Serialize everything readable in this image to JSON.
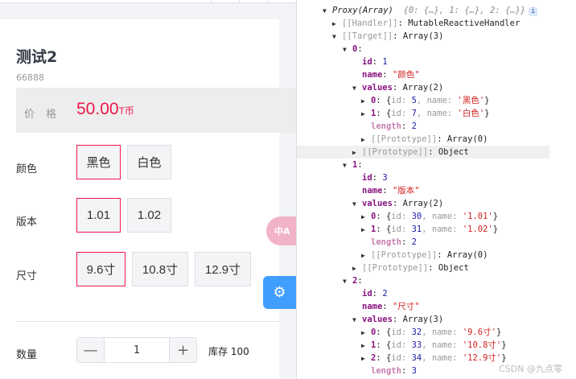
{
  "product": {
    "title": "测试2",
    "code": "66888",
    "price_label": "价格",
    "price": "50.00",
    "currency": "T币",
    "specs": [
      {
        "label": "颜色",
        "options": [
          {
            "name": "黑色",
            "selected": true
          },
          {
            "name": "白色",
            "selected": false
          }
        ]
      },
      {
        "label": "版本",
        "options": [
          {
            "name": "1.01",
            "selected": true
          },
          {
            "name": "1.02",
            "selected": false
          }
        ]
      },
      {
        "label": "尺寸",
        "options": [
          {
            "name": "9.6寸",
            "selected": true
          },
          {
            "name": "10.8寸",
            "selected": false
          },
          {
            "name": "12.9寸",
            "selected": false
          }
        ]
      }
    ],
    "quantity_label": "数量",
    "quantity": "1",
    "minus": "—",
    "plus": "+",
    "stock": "库存 100"
  },
  "floating": {
    "translate_icon": "中A",
    "settings_icon": "⚙"
  },
  "accent": "#f0164a",
  "devtools": {
    "lines": [
      {
        "d": 0,
        "a": "down",
        "parts": [
          {
            "t": "Proxy(Array)  ",
            "c": "i"
          },
          {
            "t": "{0: {…}, 1: {…}, 2: {…}}",
            "c": "ig"
          }
        ],
        "info": "i"
      },
      {
        "d": 1,
        "a": "right",
        "parts": [
          {
            "t": "[[Handler]]",
            "c": "g"
          },
          {
            "t": ": MutableReactiveHandler",
            "c": "p"
          }
        ]
      },
      {
        "d": 1,
        "a": "down",
        "parts": [
          {
            "t": "[[Target]]",
            "c": "g"
          },
          {
            "t": ": Array(3)",
            "c": "p"
          }
        ]
      },
      {
        "d": 2,
        "a": "down",
        "parts": [
          {
            "t": "0",
            "c": "k"
          },
          {
            "t": ":",
            "c": "p"
          }
        ]
      },
      {
        "d": 3,
        "a": "",
        "parts": [
          {
            "t": "id",
            "c": "k"
          },
          {
            "t": ": ",
            "c": "p"
          },
          {
            "t": "1",
            "c": "n"
          }
        ]
      },
      {
        "d": 3,
        "a": "",
        "parts": [
          {
            "t": "name",
            "c": "k"
          },
          {
            "t": ": ",
            "c": "p"
          },
          {
            "t": "\"颜色\"",
            "c": "s"
          }
        ]
      },
      {
        "d": 3,
        "a": "down",
        "parts": [
          {
            "t": "values",
            "c": "k"
          },
          {
            "t": ": Array(2)",
            "c": "p"
          }
        ]
      },
      {
        "d": 4,
        "a": "right",
        "parts": [
          {
            "t": "0",
            "c": "k"
          },
          {
            "t": ": {",
            "c": "p"
          },
          {
            "t": "id: ",
            "c": "g"
          },
          {
            "t": "5",
            "c": "n"
          },
          {
            "t": ", name: ",
            "c": "g"
          },
          {
            "t": "'黑色'",
            "c": "s"
          },
          {
            "t": "}",
            "c": "p"
          }
        ]
      },
      {
        "d": 4,
        "a": "right",
        "parts": [
          {
            "t": "1",
            "c": "k"
          },
          {
            "t": ": {",
            "c": "p"
          },
          {
            "t": "id: ",
            "c": "g"
          },
          {
            "t": "7",
            "c": "n"
          },
          {
            "t": ", name: ",
            "c": "g"
          },
          {
            "t": "'白色'",
            "c": "s"
          },
          {
            "t": "}",
            "c": "p"
          }
        ]
      },
      {
        "d": 4,
        "a": "",
        "parts": [
          {
            "t": "length",
            "c": "kl"
          },
          {
            "t": ": ",
            "c": "p"
          },
          {
            "t": "2",
            "c": "n"
          }
        ]
      },
      {
        "d": 4,
        "a": "right",
        "parts": [
          {
            "t": "[[Prototype]]",
            "c": "g"
          },
          {
            "t": ": Array(0)",
            "c": "p"
          }
        ]
      },
      {
        "d": 3,
        "a": "right",
        "hl": true,
        "parts": [
          {
            "t": "[[Prototype]]",
            "c": "g"
          },
          {
            "t": ": Object",
            "c": "p"
          }
        ]
      },
      {
        "d": 2,
        "a": "down",
        "parts": [
          {
            "t": "1",
            "c": "k"
          },
          {
            "t": ":",
            "c": "p"
          }
        ]
      },
      {
        "d": 3,
        "a": "",
        "parts": [
          {
            "t": "id",
            "c": "k"
          },
          {
            "t": ": ",
            "c": "p"
          },
          {
            "t": "3",
            "c": "n"
          }
        ]
      },
      {
        "d": 3,
        "a": "",
        "parts": [
          {
            "t": "name",
            "c": "k"
          },
          {
            "t": ": ",
            "c": "p"
          },
          {
            "t": "\"版本\"",
            "c": "s"
          }
        ]
      },
      {
        "d": 3,
        "a": "down",
        "parts": [
          {
            "t": "values",
            "c": "k"
          },
          {
            "t": ": Array(2)",
            "c": "p"
          }
        ]
      },
      {
        "d": 4,
        "a": "right",
        "parts": [
          {
            "t": "0",
            "c": "k"
          },
          {
            "t": ": {",
            "c": "p"
          },
          {
            "t": "id: ",
            "c": "g"
          },
          {
            "t": "30",
            "c": "n"
          },
          {
            "t": ", name: ",
            "c": "g"
          },
          {
            "t": "'1.01'",
            "c": "s"
          },
          {
            "t": "}",
            "c": "p"
          }
        ]
      },
      {
        "d": 4,
        "a": "right",
        "parts": [
          {
            "t": "1",
            "c": "k"
          },
          {
            "t": ": {",
            "c": "p"
          },
          {
            "t": "id: ",
            "c": "g"
          },
          {
            "t": "31",
            "c": "n"
          },
          {
            "t": ", name: ",
            "c": "g"
          },
          {
            "t": "'1.02'",
            "c": "s"
          },
          {
            "t": "}",
            "c": "p"
          }
        ]
      },
      {
        "d": 4,
        "a": "",
        "parts": [
          {
            "t": "length",
            "c": "kl"
          },
          {
            "t": ": ",
            "c": "p"
          },
          {
            "t": "2",
            "c": "n"
          }
        ]
      },
      {
        "d": 4,
        "a": "right",
        "parts": [
          {
            "t": "[[Prototype]]",
            "c": "g"
          },
          {
            "t": ": Array(0)",
            "c": "p"
          }
        ]
      },
      {
        "d": 3,
        "a": "right",
        "parts": [
          {
            "t": "[[Prototype]]",
            "c": "g"
          },
          {
            "t": ": Object",
            "c": "p"
          }
        ]
      },
      {
        "d": 2,
        "a": "down",
        "parts": [
          {
            "t": "2",
            "c": "k"
          },
          {
            "t": ":",
            "c": "p"
          }
        ]
      },
      {
        "d": 3,
        "a": "",
        "parts": [
          {
            "t": "id",
            "c": "k"
          },
          {
            "t": ": ",
            "c": "p"
          },
          {
            "t": "2",
            "c": "n"
          }
        ]
      },
      {
        "d": 3,
        "a": "",
        "parts": [
          {
            "t": "name",
            "c": "k"
          },
          {
            "t": ": ",
            "c": "p"
          },
          {
            "t": "\"尺寸\"",
            "c": "s"
          }
        ]
      },
      {
        "d": 3,
        "a": "down",
        "parts": [
          {
            "t": "values",
            "c": "k"
          },
          {
            "t": ": Array(3)",
            "c": "p"
          }
        ]
      },
      {
        "d": 4,
        "a": "right",
        "parts": [
          {
            "t": "0",
            "c": "k"
          },
          {
            "t": ": {",
            "c": "p"
          },
          {
            "t": "id: ",
            "c": "g"
          },
          {
            "t": "32",
            "c": "n"
          },
          {
            "t": ", name: ",
            "c": "g"
          },
          {
            "t": "'9.6寸'",
            "c": "s"
          },
          {
            "t": "}",
            "c": "p"
          }
        ]
      },
      {
        "d": 4,
        "a": "right",
        "parts": [
          {
            "t": "1",
            "c": "k"
          },
          {
            "t": ": {",
            "c": "p"
          },
          {
            "t": "id: ",
            "c": "g"
          },
          {
            "t": "33",
            "c": "n"
          },
          {
            "t": ", name: ",
            "c": "g"
          },
          {
            "t": "'10.8寸'",
            "c": "s"
          },
          {
            "t": "}",
            "c": "p"
          }
        ]
      },
      {
        "d": 4,
        "a": "right",
        "parts": [
          {
            "t": "2",
            "c": "k"
          },
          {
            "t": ": {",
            "c": "p"
          },
          {
            "t": "id: ",
            "c": "g"
          },
          {
            "t": "34",
            "c": "n"
          },
          {
            "t": ", name: ",
            "c": "g"
          },
          {
            "t": "'12.9寸'",
            "c": "s"
          },
          {
            "t": "}",
            "c": "p"
          }
        ]
      },
      {
        "d": 4,
        "a": "",
        "parts": [
          {
            "t": "length",
            "c": "kl"
          },
          {
            "t": ": ",
            "c": "p"
          },
          {
            "t": "3",
            "c": "n"
          }
        ]
      }
    ]
  },
  "watermark": "CSDN @九点零"
}
